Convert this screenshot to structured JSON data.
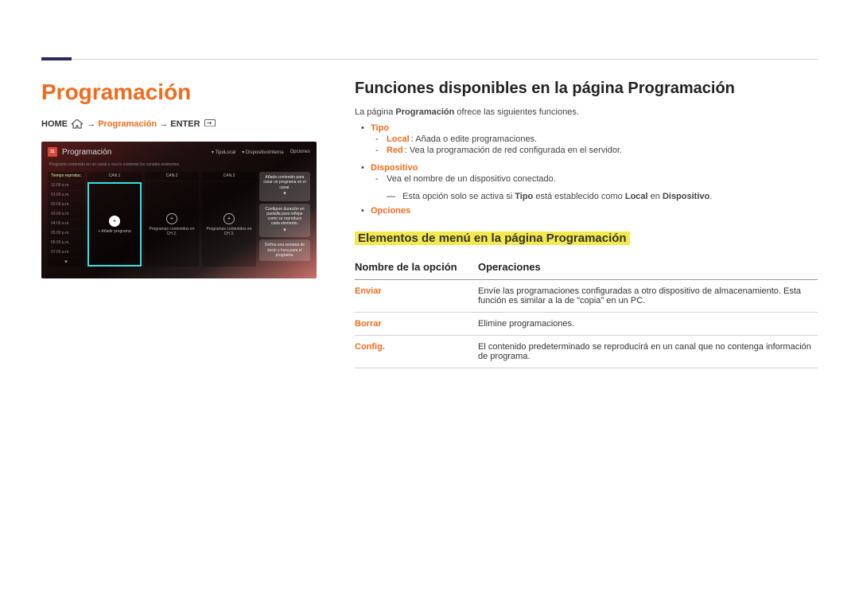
{
  "left": {
    "title": "Programación",
    "breadcrumb": {
      "home": "HOME",
      "mid": "Programación",
      "enter": "ENTER",
      "arrow": "→"
    },
    "mock": {
      "header_title": "Programación",
      "header_icon_text": "31",
      "header_right": [
        "TipoLocal",
        "DispositivoInterna",
        "Opciones"
      ],
      "subtitle": "Programe contenido en un canal o vea lo existente los canales existentes.",
      "time_header": "Tiempo reproduc.",
      "times": [
        "12:00 a.m.",
        "01:00 a.m.",
        "02:00 a.m.",
        "03:00 a.m.",
        "04:00 a.m.",
        "05:00 p.m.",
        "06:00 p.m.",
        "07:00 a.m."
      ],
      "channels": [
        {
          "head": "CAN.1",
          "label": "+ Añadir programa",
          "selected": true
        },
        {
          "head": "CAN.2",
          "label": "Programas contenidos en CH 2.",
          "selected": false
        },
        {
          "head": "CAN.3",
          "label": "Programas contenidos en CH 3.",
          "selected": false
        }
      ],
      "bubbles": [
        "Añada contenido para crear un programa en el canal.",
        "Configure duración en pantalla para reflejar como se reproduce cada elemento.",
        "Defina una semana de inicio y hora para el programa."
      ]
    }
  },
  "right": {
    "h2": "Funciones disponibles en la página Programación",
    "intro": {
      "pre": "La página ",
      "bold": "Programación",
      "post": " ofrece las siguientes funciones."
    },
    "funcs": [
      {
        "key": "Tipo",
        "subs": [
          {
            "k": "Local",
            "text": ": Añada o edite programaciones."
          },
          {
            "k": "Red",
            "text": ": Vea la programación de red configurada en el servidor."
          }
        ]
      },
      {
        "key": "Dispositivo",
        "subs": [
          {
            "text": "Vea el nombre de un dispositivo conectado."
          }
        ],
        "note": {
          "pre": "Esta opción solo se activa si ",
          "b1": "Tipo",
          "mid": " está establecido como ",
          "b2": "Local",
          "mid2": " en ",
          "b3": "Dispositivo",
          "post": "."
        }
      },
      {
        "key": "Opciones"
      }
    ],
    "subhead": "Elementos de menú en la página Programación",
    "table": {
      "col1": "Nombre de la opción",
      "col2": "Operaciones",
      "rows": [
        {
          "name": "Enviar",
          "op": "Envíe las programaciones configuradas a otro dispositivo de almacenamiento. Esta función es similar a la de \"copia\" en un PC."
        },
        {
          "name": "Borrar",
          "op": "Elimine programaciones."
        },
        {
          "name": "Config.",
          "op": "El contenido predeterminado se reproducirá en un canal que no contenga información de programa."
        }
      ]
    }
  }
}
